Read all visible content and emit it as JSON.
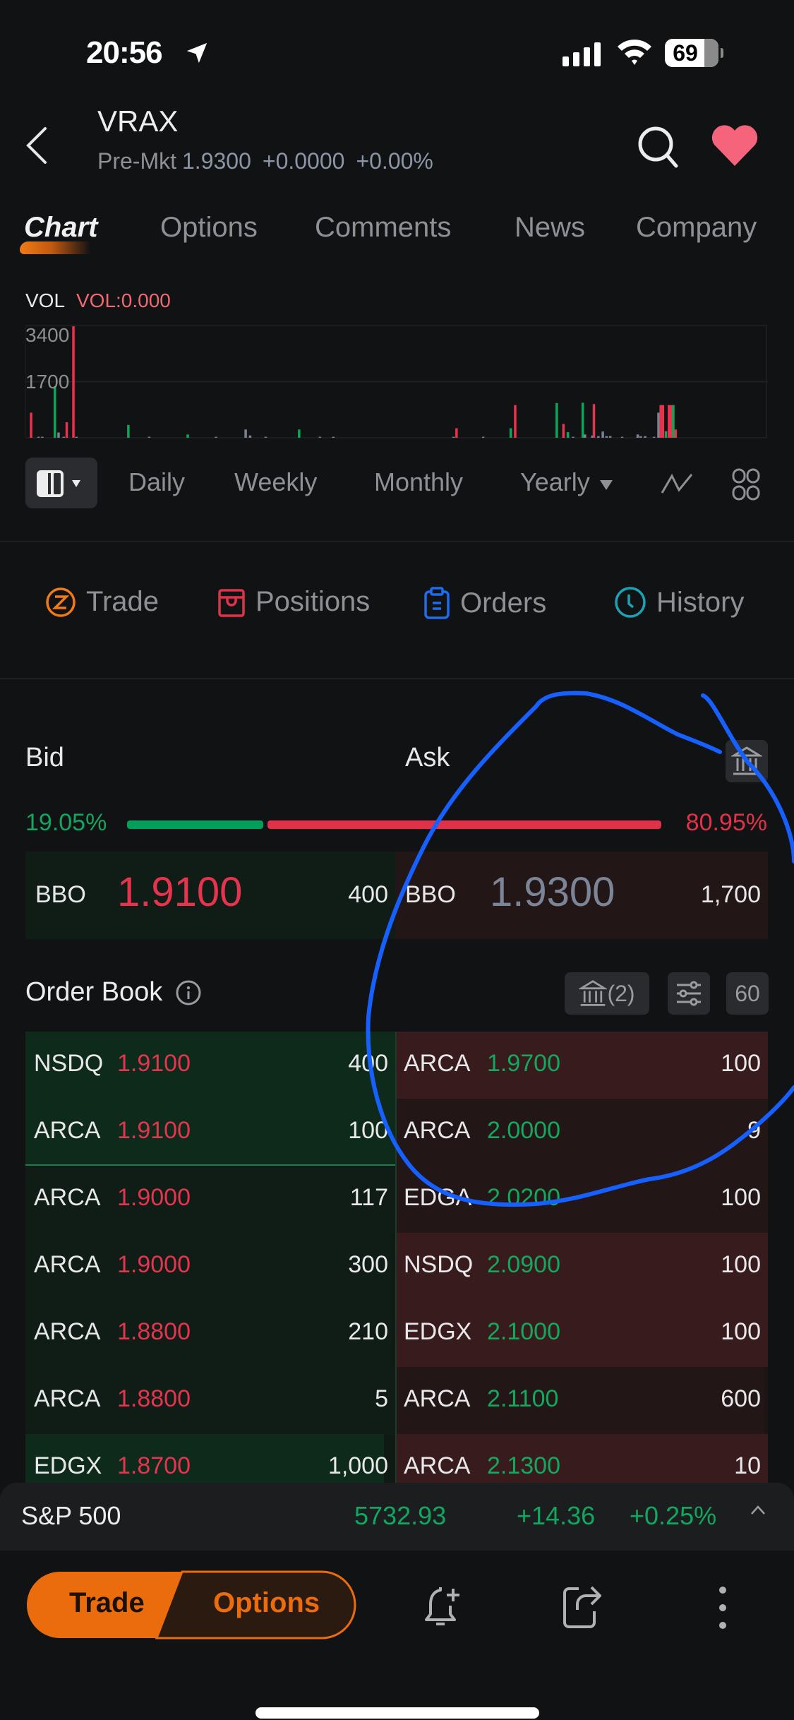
{
  "status_bar": {
    "time": "20:56",
    "battery": "69",
    "icons": [
      "location-arrow-icon",
      "cellular-signal-icon",
      "wifi-icon",
      "battery-icon"
    ]
  },
  "header": {
    "ticker": "VRAX",
    "session_label": "Pre-Mkt",
    "price": "1.9300",
    "change": "+0.0000",
    "change_pct": "+0.00%",
    "favorited": true
  },
  "tabs": [
    {
      "label": "Chart",
      "active": true
    },
    {
      "label": "Options",
      "active": false
    },
    {
      "label": "Comments",
      "active": false
    },
    {
      "label": "News",
      "active": false
    },
    {
      "label": "Company",
      "active": false
    }
  ],
  "volume_panel": {
    "label": "VOL",
    "value_label": "VOL:0.000"
  },
  "chart_data": {
    "type": "bar",
    "title": "VOL",
    "ylabel": "",
    "xlabel": "",
    "ylim": [
      0,
      3400
    ],
    "yticks": [
      "3400",
      "1700"
    ],
    "grid": true,
    "legend": "none",
    "series": [
      {
        "name": "volume",
        "values": [
          {
            "x": 0.6,
            "v": 760,
            "c": "down"
          },
          {
            "x": 1.6,
            "v": 30,
            "c": "flat"
          },
          {
            "x": 2.1,
            "v": 30,
            "c": "flat"
          },
          {
            "x": 3.8,
            "v": 1560,
            "c": "up"
          },
          {
            "x": 4.3,
            "v": 160,
            "c": "flat"
          },
          {
            "x": 5.0,
            "v": 30,
            "c": "flat"
          },
          {
            "x": 5.4,
            "v": 470,
            "c": "down"
          },
          {
            "x": 6.3,
            "v": 3380,
            "c": "down"
          },
          {
            "x": 6.7,
            "v": 30,
            "c": "flat"
          },
          {
            "x": 13.7,
            "v": 390,
            "c": "up"
          },
          {
            "x": 16.5,
            "v": 30,
            "c": "flat"
          },
          {
            "x": 21.7,
            "v": 100,
            "c": "up"
          },
          {
            "x": 25.5,
            "v": 30,
            "c": "flat"
          },
          {
            "x": 29.5,
            "v": 250,
            "c": "flat"
          },
          {
            "x": 30.1,
            "v": 70,
            "c": "flat"
          },
          {
            "x": 32.2,
            "v": 30,
            "c": "flat"
          },
          {
            "x": 36.7,
            "v": 250,
            "c": "up"
          },
          {
            "x": 39.5,
            "v": 30,
            "c": "flat"
          },
          {
            "x": 41.3,
            "v": 30,
            "c": "flat"
          },
          {
            "x": 57.5,
            "v": 30,
            "c": "flat"
          },
          {
            "x": 57.9,
            "v": 290,
            "c": "down"
          },
          {
            "x": 61.5,
            "v": 30,
            "c": "flat"
          },
          {
            "x": 65.2,
            "v": 290,
            "c": "up"
          },
          {
            "x": 65.8,
            "v": 990,
            "c": "down"
          },
          {
            "x": 71.4,
            "v": 1050,
            "c": "up"
          },
          {
            "x": 72.3,
            "v": 420,
            "c": "down"
          },
          {
            "x": 72.9,
            "v": 170,
            "c": "up"
          },
          {
            "x": 73.6,
            "v": 30,
            "c": "flat"
          },
          {
            "x": 74.9,
            "v": 1060,
            "c": "up"
          },
          {
            "x": 75.2,
            "v": 100,
            "c": "flat"
          },
          {
            "x": 76.2,
            "v": 70,
            "c": "flat"
          },
          {
            "x": 76.4,
            "v": 1020,
            "c": "down"
          },
          {
            "x": 77.0,
            "v": 50,
            "c": "flat"
          },
          {
            "x": 77.6,
            "v": 190,
            "c": "flat"
          },
          {
            "x": 78.1,
            "v": 50,
            "c": "flat"
          },
          {
            "x": 78.6,
            "v": 50,
            "c": "flat"
          },
          {
            "x": 80.2,
            "v": 30,
            "c": "flat"
          },
          {
            "x": 82.3,
            "v": 100,
            "c": "flat"
          },
          {
            "x": 82.7,
            "v": 50,
            "c": "flat"
          },
          {
            "x": 83.3,
            "v": 50,
            "c": "flat"
          },
          {
            "x": 84.5,
            "v": 30,
            "c": "flat"
          },
          {
            "x": 85.1,
            "v": 760,
            "c": "flat"
          },
          {
            "x": 85.4,
            "v": 990,
            "c": "down"
          },
          {
            "x": 85.7,
            "v": 990,
            "c": "down"
          },
          {
            "x": 86.1,
            "v": 200,
            "c": "up"
          },
          {
            "x": 86.5,
            "v": 990,
            "c": "down"
          },
          {
            "x": 86.8,
            "v": 990,
            "c": "down"
          },
          {
            "x": 87.1,
            "v": 990,
            "c": "up"
          },
          {
            "x": 87.4,
            "v": 250,
            "c": "down"
          }
        ]
      }
    ],
    "x_range": [
      0,
      100
    ]
  },
  "period_bar": {
    "items": [
      "Daily",
      "Weekly",
      "Monthly",
      "Yearly"
    ]
  },
  "actions": [
    {
      "label": "Trade",
      "icon": "trade-z-icon",
      "color": "#f07a16"
    },
    {
      "label": "Positions",
      "icon": "positions-box-icon",
      "color": "#e1324a"
    },
    {
      "label": "Orders",
      "icon": "clipboard-icon",
      "color": "#1e6cf0"
    },
    {
      "label": "History",
      "icon": "clock-icon",
      "color": "#1aa3b4"
    }
  ],
  "bid_ask": {
    "bid_title": "Bid",
    "ask_title": "Ask",
    "bid_pct": "19.05%",
    "ask_pct": "80.95%",
    "bid_ratio": 0.1905,
    "bbo": {
      "bid": {
        "label": "BBO",
        "price": "1.9100",
        "size": "400"
      },
      "ask": {
        "label": "BBO",
        "price": "1.9300",
        "size": "1,700"
      }
    }
  },
  "order_book": {
    "title": "Order Book",
    "exchanges_label": "(2)",
    "depth_label": "60",
    "rows": [
      {
        "bid": {
          "ex": "NSDQ",
          "price": "1.9100",
          "size": "400",
          "depth": 1.0,
          "hl": true
        },
        "ask": {
          "ex": "ARCA",
          "price": "1.9700",
          "size": "100",
          "depth": 1.0,
          "hl": true
        }
      },
      {
        "bid": {
          "ex": "ARCA",
          "price": "1.9100",
          "size": "100",
          "depth": 1.0,
          "hl": true
        },
        "ask": {
          "ex": "ARCA",
          "price": "2.0000",
          "size": "9",
          "depth": 1.0,
          "hl": false
        }
      },
      {
        "bid": {
          "ex": "ARCA",
          "price": "1.9000",
          "size": "117",
          "depth": 1.0,
          "hl": false
        },
        "ask": {
          "ex": "EDGA",
          "price": "2.0200",
          "size": "100",
          "depth": 1.0,
          "hl": false
        }
      },
      {
        "bid": {
          "ex": "ARCA",
          "price": "1.9000",
          "size": "300",
          "depth": 0.99,
          "hl": false
        },
        "ask": {
          "ex": "NSDQ",
          "price": "2.0900",
          "size": "100",
          "depth": 1.0,
          "hl": true
        }
      },
      {
        "bid": {
          "ex": "ARCA",
          "price": "1.8800",
          "size": "210",
          "depth": 0.99,
          "hl": false
        },
        "ask": {
          "ex": "EDGX",
          "price": "2.1000",
          "size": "100",
          "depth": 1.0,
          "hl": true
        }
      },
      {
        "bid": {
          "ex": "ARCA",
          "price": "1.8800",
          "size": "5",
          "depth": 1.0,
          "hl": false
        },
        "ask": {
          "ex": "ARCA",
          "price": "2.1100",
          "size": "600",
          "depth": 0.99,
          "hl": false
        }
      },
      {
        "bid": {
          "ex": "EDGX",
          "price": "1.8700",
          "size": "1,000",
          "depth": 0.97,
          "hl": true
        },
        "ask": {
          "ex": "ARCA",
          "price": "2.1300",
          "size": "10",
          "depth": 1.0,
          "hl": true
        }
      }
    ]
  },
  "index_ticker": {
    "name": "S&P 500",
    "value": "5732.93",
    "change": "+14.36",
    "change_pct": "+0.25%"
  },
  "bottom_bar": {
    "trade_label": "Trade",
    "options_label": "Options"
  },
  "colors": {
    "accent": "#f07a16",
    "up": "#12a95f",
    "down": "#e8334f",
    "background": "#111214"
  }
}
